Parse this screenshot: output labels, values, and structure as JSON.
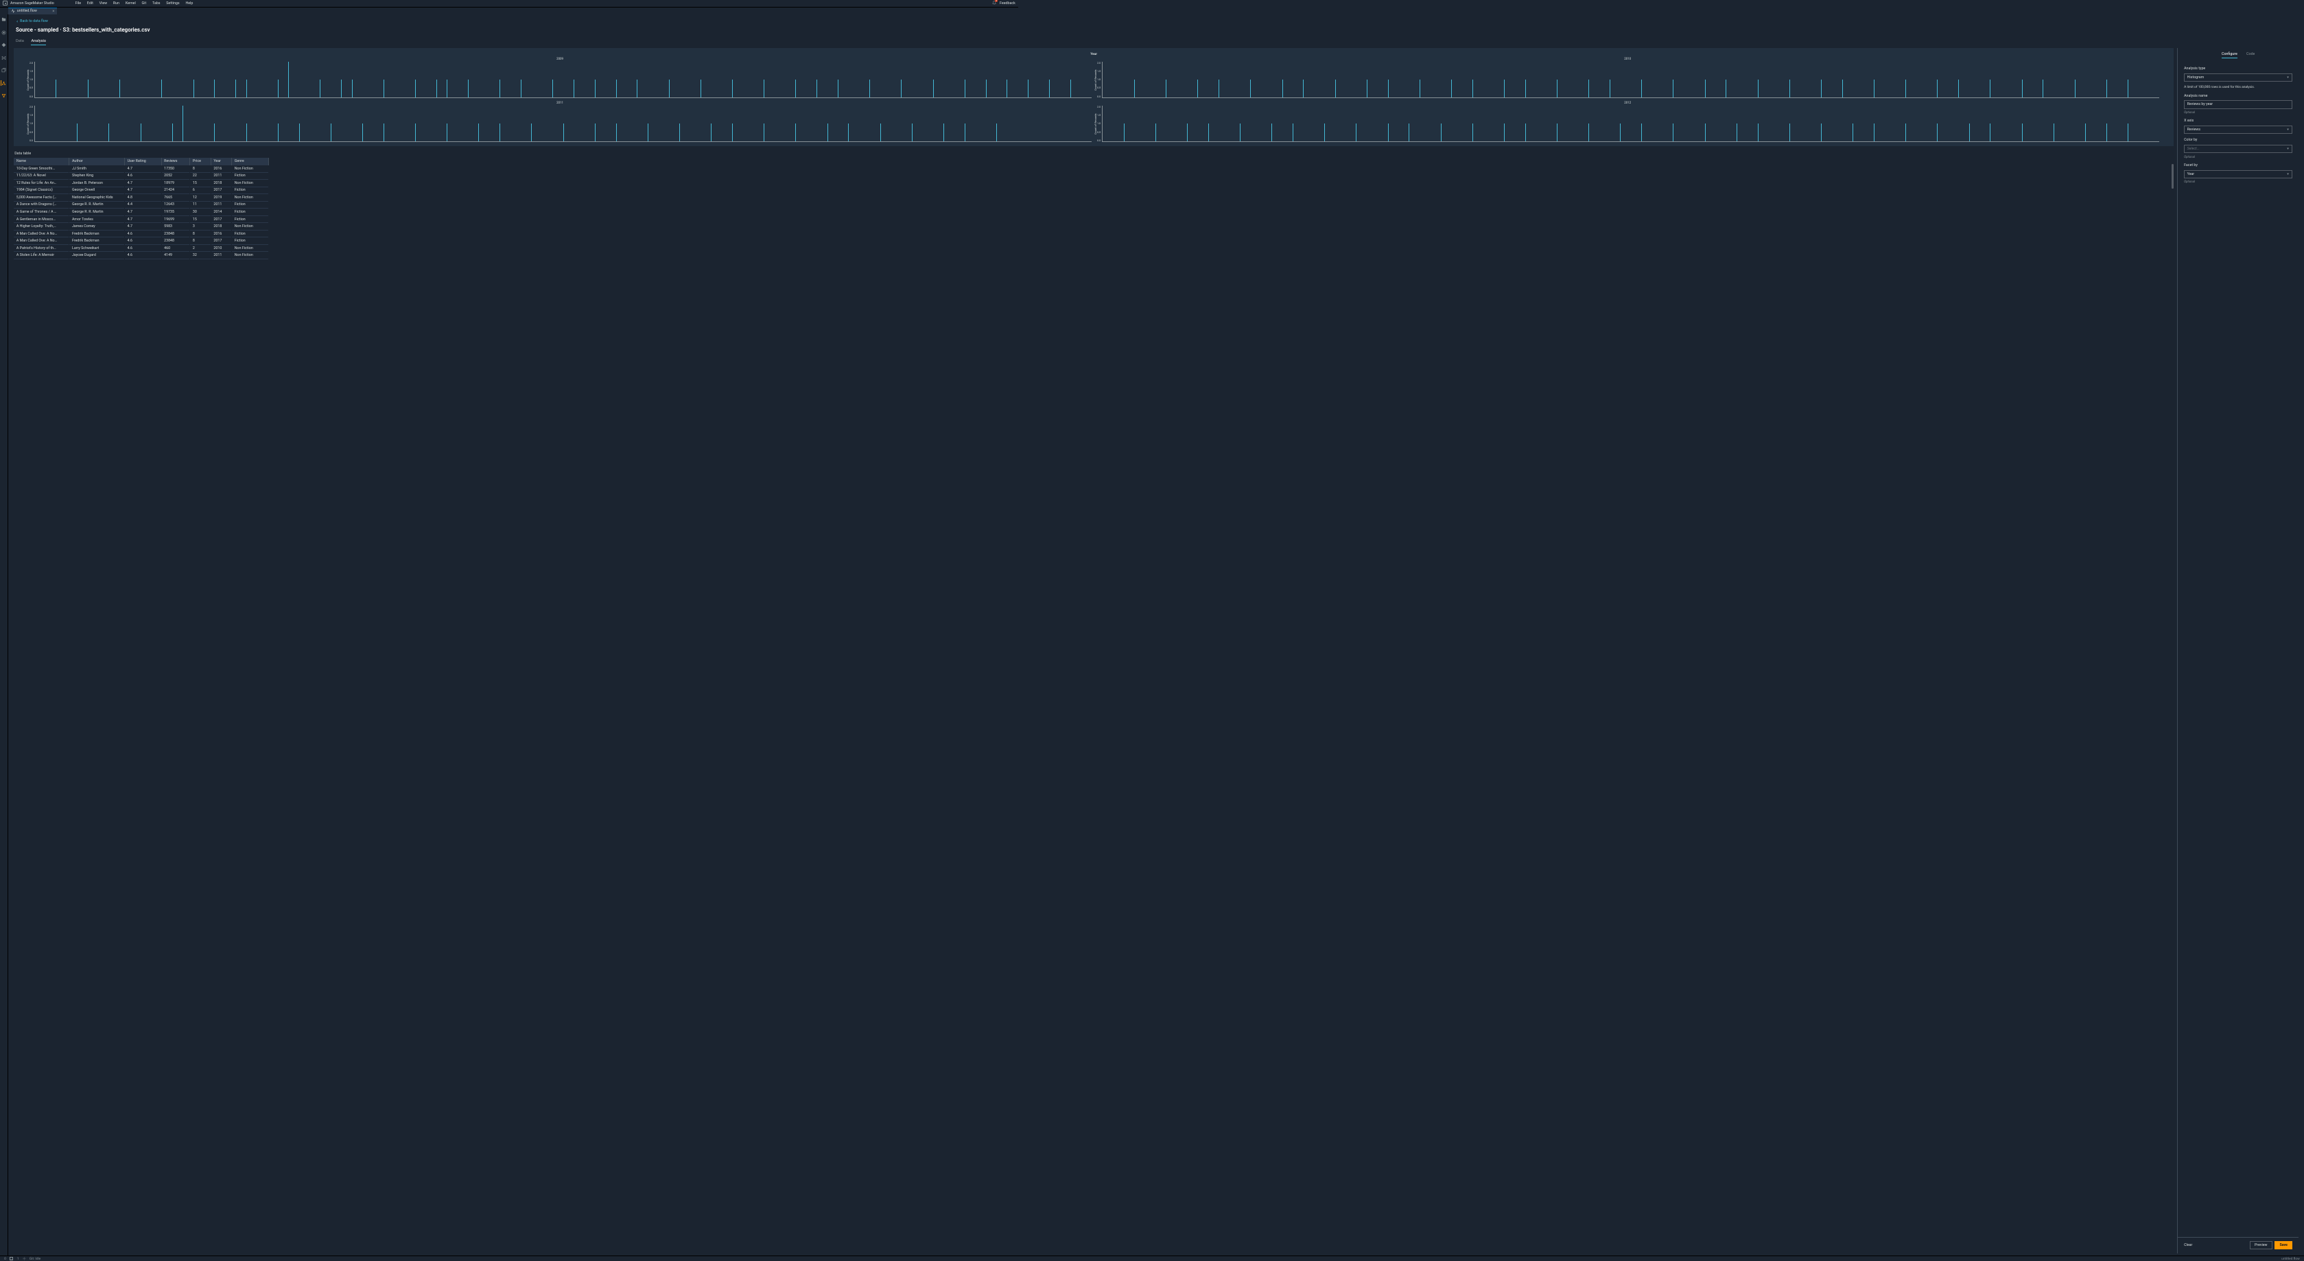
{
  "app_title": "Amazon SageMaker Studio",
  "menu": [
    "File",
    "Edit",
    "View",
    "Run",
    "Kernel",
    "Git",
    "Tabs",
    "Settings",
    "Help"
  ],
  "notification_count": "4",
  "feedback": "Feedback",
  "tab": {
    "name": "untitled.flow"
  },
  "back_link": "Back to data flow",
  "source_title": "Source - sampled · S3: bestsellers_with_categories.csv",
  "subtabs": {
    "data": "Data",
    "analysis": "Analysis"
  },
  "chart_data": {
    "type": "histogram",
    "title": "Year",
    "ylabel": "Count of Records",
    "ylim": [
      0,
      2
    ],
    "yticks": [
      "2.0",
      "1.5",
      "1.0",
      "0.5",
      "0.0"
    ],
    "facets": [
      {
        "label": "2009",
        "bars": [
          [
            2,
            1
          ],
          [
            5,
            1
          ],
          [
            8,
            1
          ],
          [
            12,
            1
          ],
          [
            15,
            1
          ],
          [
            17,
            1
          ],
          [
            19,
            1
          ],
          [
            20,
            1
          ],
          [
            23,
            1
          ],
          [
            24,
            2
          ],
          [
            27,
            1
          ],
          [
            29,
            1
          ],
          [
            30,
            1
          ],
          [
            33,
            1
          ],
          [
            36,
            1
          ],
          [
            38,
            1
          ],
          [
            39,
            1
          ],
          [
            41,
            1
          ],
          [
            44,
            1
          ],
          [
            46,
            1
          ],
          [
            49,
            1
          ],
          [
            51,
            1
          ],
          [
            53,
            1
          ],
          [
            55,
            1
          ],
          [
            57,
            1
          ],
          [
            60,
            1
          ],
          [
            63,
            1
          ],
          [
            66,
            1
          ],
          [
            69,
            1
          ],
          [
            72,
            1
          ],
          [
            74,
            1
          ],
          [
            76,
            1
          ],
          [
            79,
            1
          ],
          [
            82,
            1
          ],
          [
            85,
            1
          ],
          [
            88,
            1
          ],
          [
            90,
            1
          ],
          [
            92,
            1
          ],
          [
            94,
            1
          ],
          [
            96,
            1
          ],
          [
            98,
            1
          ]
        ]
      },
      {
        "label": "2010",
        "bars": [
          [
            3,
            1
          ],
          [
            6,
            1
          ],
          [
            9,
            1
          ],
          [
            11,
            1
          ],
          [
            14,
            1
          ],
          [
            17,
            1
          ],
          [
            19,
            1
          ],
          [
            22,
            1
          ],
          [
            25,
            1
          ],
          [
            27,
            1
          ],
          [
            30,
            1
          ],
          [
            33,
            1
          ],
          [
            35,
            1
          ],
          [
            38,
            1
          ],
          [
            40,
            1
          ],
          [
            43,
            1
          ],
          [
            46,
            1
          ],
          [
            48,
            1
          ],
          [
            51,
            1
          ],
          [
            54,
            1
          ],
          [
            57,
            1
          ],
          [
            59,
            1
          ],
          [
            62,
            1
          ],
          [
            65,
            1
          ],
          [
            68,
            1
          ],
          [
            70,
            1
          ],
          [
            73,
            1
          ],
          [
            76,
            1
          ],
          [
            79,
            1
          ],
          [
            81,
            1
          ],
          [
            84,
            1
          ],
          [
            87,
            1
          ],
          [
            89,
            1
          ],
          [
            92,
            1
          ],
          [
            95,
            1
          ],
          [
            97,
            1
          ]
        ]
      },
      {
        "label": "2011",
        "bars": [
          [
            4,
            1
          ],
          [
            7,
            1
          ],
          [
            10,
            1
          ],
          [
            13,
            1
          ],
          [
            14,
            2
          ],
          [
            17,
            1
          ],
          [
            20,
            1
          ],
          [
            23,
            1
          ],
          [
            25,
            1
          ],
          [
            28,
            1
          ],
          [
            31,
            1
          ],
          [
            33,
            1
          ],
          [
            36,
            1
          ],
          [
            39,
            1
          ],
          [
            42,
            1
          ],
          [
            44,
            1
          ],
          [
            47,
            1
          ],
          [
            50,
            1
          ],
          [
            53,
            1
          ],
          [
            55,
            1
          ],
          [
            58,
            1
          ],
          [
            61,
            1
          ],
          [
            64,
            1
          ],
          [
            66,
            1
          ],
          [
            69,
            1
          ],
          [
            72,
            1
          ],
          [
            75,
            1
          ],
          [
            77,
            1
          ],
          [
            80,
            1
          ],
          [
            83,
            1
          ],
          [
            86,
            1
          ],
          [
            88,
            1
          ],
          [
            91,
            1
          ]
        ]
      },
      {
        "label": "2012",
        "bars": [
          [
            2,
            1
          ],
          [
            5,
            1
          ],
          [
            8,
            1
          ],
          [
            10,
            1
          ],
          [
            13,
            1
          ],
          [
            16,
            1
          ],
          [
            18,
            1
          ],
          [
            21,
            1
          ],
          [
            24,
            1
          ],
          [
            27,
            1
          ],
          [
            29,
            1
          ],
          [
            32,
            1
          ],
          [
            35,
            1
          ],
          [
            38,
            1
          ],
          [
            40,
            1
          ],
          [
            43,
            1
          ],
          [
            46,
            1
          ],
          [
            49,
            1
          ],
          [
            51,
            1
          ],
          [
            54,
            1
          ],
          [
            57,
            1
          ],
          [
            60,
            1
          ],
          [
            62,
            1
          ],
          [
            65,
            1
          ],
          [
            68,
            1
          ],
          [
            71,
            1
          ],
          [
            73,
            1
          ],
          [
            76,
            1
          ],
          [
            79,
            1
          ],
          [
            82,
            1
          ],
          [
            84,
            1
          ],
          [
            87,
            1
          ],
          [
            90,
            1
          ],
          [
            93,
            1
          ],
          [
            95,
            1
          ],
          [
            97,
            1
          ]
        ]
      }
    ]
  },
  "table": {
    "label": "Data table",
    "headers": [
      "Name",
      "Author",
      "User Rating",
      "Reviews",
      "Price",
      "Year",
      "Genre"
    ],
    "rows": [
      [
        "10-Day Green Smoothi…",
        "JJ Smith",
        "4.7",
        "17350",
        "8",
        "2016",
        "Non Fiction"
      ],
      [
        "11/22/63: A Novel",
        "Stephen King",
        "4.6",
        "2052",
        "22",
        "2011",
        "Fiction"
      ],
      [
        "12 Rules for Life: An An…",
        "Jordan B. Peterson",
        "4.7",
        "18979",
        "15",
        "2018",
        "Non Fiction"
      ],
      [
        "1984 (Signet Classics)",
        "George Orwell",
        "4.7",
        "21424",
        "6",
        "2017",
        "Fiction"
      ],
      [
        "5,000 Awesome Facts (…",
        "National Geographic Kids",
        "4.8",
        "7665",
        "12",
        "2019",
        "Non Fiction"
      ],
      [
        "A Dance with Dragons (…",
        "George R. R. Martin",
        "4.4",
        "12643",
        "11",
        "2011",
        "Fiction"
      ],
      [
        "A Game of Thrones / A …",
        "George R. R. Martin",
        "4.7",
        "19735",
        "30",
        "2014",
        "Fiction"
      ],
      [
        "A Gentleman in Mosco…",
        "Amor Towles",
        "4.7",
        "19699",
        "15",
        "2017",
        "Fiction"
      ],
      [
        "A Higher Loyalty: Truth,…",
        "James Comey",
        "4.7",
        "5983",
        "3",
        "2018",
        "Non Fiction"
      ],
      [
        "A Man Called Ove: A No…",
        "Fredrik Backman",
        "4.6",
        "23848",
        "8",
        "2016",
        "Fiction"
      ],
      [
        "A Man Called Ove: A No…",
        "Fredrik Backman",
        "4.6",
        "23848",
        "8",
        "2017",
        "Fiction"
      ],
      [
        "A Patriot's History of th…",
        "Larry Schweikart",
        "4.6",
        "460",
        "2",
        "2010",
        "Non Fiction"
      ],
      [
        "A Stolen Life: A Memoir",
        "Jaycee Dugard",
        "4.6",
        "4149",
        "32",
        "2011",
        "Non Fiction"
      ]
    ]
  },
  "config": {
    "tabs": {
      "configure": "Configure",
      "code": "Code"
    },
    "analysis_type_label": "Analysis type",
    "analysis_type_value": "Histogram",
    "limit_note": "A limit of 100,000 rows is used for this analysis.",
    "analysis_name_label": "Analysis name",
    "analysis_name_value": "Reviews by year",
    "optional": "Optional",
    "xaxis_label": "X axis",
    "xaxis_value": "Reviews",
    "colorby_label": "Color by",
    "colorby_placeholder": "Select...",
    "facetby_label": "Facet by",
    "facetby_value": "Year",
    "clear": "Clear",
    "preview": "Preview",
    "save": "Save"
  },
  "status": {
    "left1": "0",
    "left2": "1",
    "git": "Git: Idle",
    "right": "untitled.flow"
  }
}
